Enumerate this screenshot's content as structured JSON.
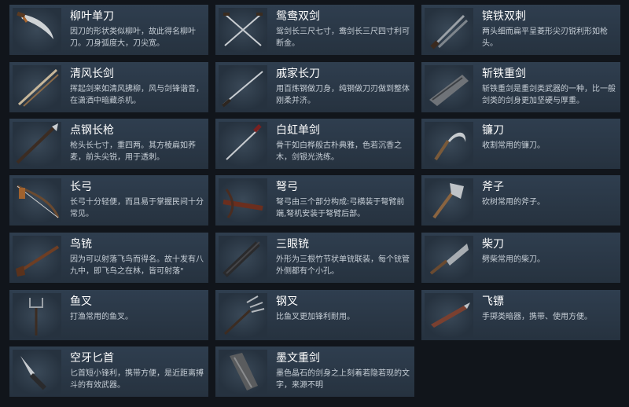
{
  "items": [
    {
      "name": "柳叶单刀",
      "desc": "因刀的形状类似柳叶，故此得名柳叶刀。刀身弧度大，刀尖宽。",
      "icon": "willow-leaf-saber-icon"
    },
    {
      "name": "鸳鸯双剑",
      "desc": "鸳剑长三尺七寸，鸯剑长三尺四寸利可断金。",
      "icon": "twin-swords-icon"
    },
    {
      "name": "镔铁双刺",
      "desc": "两头细而扁平呈菱形尖刃锐利形如枪头。",
      "icon": "twin-daggers-icon"
    },
    {
      "name": "清风长剑",
      "desc": "挥起剑来如清风拂柳，风与剑锋谐音，在潇洒中暗藏杀机。",
      "icon": "long-sword-icon"
    },
    {
      "name": "戚家长刀",
      "desc": "用百炼钢做刀身，纯钢做刀刃做到整体刚柔并济。",
      "icon": "long-saber-icon"
    },
    {
      "name": "斩铁重剑",
      "desc": "斩铁重剑是重剑类武器的一种，比一般剑类的剑身更加坚硬与厚重。",
      "icon": "heavy-sword-icon"
    },
    {
      "name": "点钢长枪",
      "desc": "枪头长七寸，重四两。其方棱扁如荞麦，前头尖锐，用于透刺。",
      "icon": "spear-icon"
    },
    {
      "name": "白虹单剑",
      "desc": "骨干如白桦般古朴典雅，色若沉香之木，剑银光洗练。",
      "icon": "single-sword-icon"
    },
    {
      "name": "镰刀",
      "desc": "收割常用的镰刀。",
      "icon": "sickle-icon"
    },
    {
      "name": "长弓",
      "desc": "长弓十分轻便，而且易于掌握民间十分常见。",
      "icon": "longbow-icon"
    },
    {
      "name": "弩弓",
      "desc": "弩弓由三个部分构成:弓横装于弩臂前端,弩机安装于弩臂后部。",
      "icon": "crossbow-icon"
    },
    {
      "name": "斧子",
      "desc": "砍树常用的斧子。",
      "icon": "axe-icon"
    },
    {
      "name": "鸟铳",
      "desc": "因为可以射落飞鸟而得名。故十发有八九中，即飞鸟之在林，皆可射落\"",
      "icon": "musket-icon"
    },
    {
      "name": "三眼铳",
      "desc": "外形为三根竹节状单铳联装，每个铳管外侧都有个小孔。",
      "icon": "three-barrel-gun-icon"
    },
    {
      "name": "柴刀",
      "desc": "劈柴常用的柴刀。",
      "icon": "machete-icon"
    },
    {
      "name": "鱼叉",
      "desc": "打渔常用的鱼叉。",
      "icon": "fish-spear-icon"
    },
    {
      "name": "钢叉",
      "desc": "比鱼叉更加锋利耐用。",
      "icon": "trident-icon"
    },
    {
      "name": "飞镖",
      "desc": "手掷类暗器，携带、使用方便。",
      "icon": "dart-icon"
    },
    {
      "name": "空牙匕首",
      "desc": "匕首短小锋利，携带方便，是近距离搏斗的有效武器。",
      "icon": "dagger-icon"
    },
    {
      "name": "墨文重剑",
      "desc": "墨色晶石的剑身之上刻着若隐若现的文字，来源不明",
      "icon": "ink-heavy-sword-icon"
    }
  ]
}
